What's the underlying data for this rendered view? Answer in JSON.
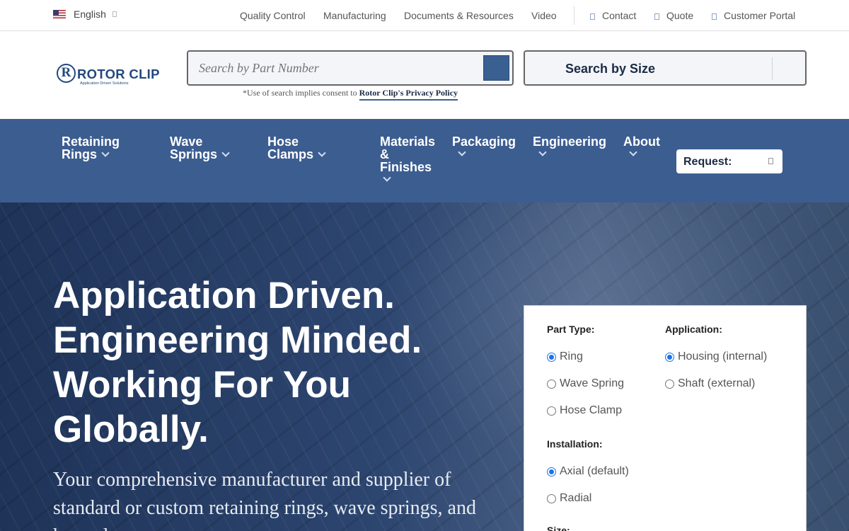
{
  "topbar": {
    "language": "English",
    "links": [
      "Quality Control",
      "Manufacturing",
      "Documents & Resources",
      "Video"
    ],
    "contact": "Contact",
    "quote": "Quote",
    "portal": "Customer Portal"
  },
  "logo": {
    "name": "ROTOR CLIP",
    "initial": "R",
    "tagline": "Application Driven Solutions"
  },
  "search": {
    "part_placeholder": "Search by Part Number",
    "size_label": "Search by Size",
    "privacy_prefix": "*Use of search implies consent to ",
    "privacy_link": "Rotor Clip's Privacy Policy"
  },
  "nav": {
    "items": [
      "Retaining Rings",
      "Wave Springs",
      "Hose Clamps",
      "Materials & Finishes",
      "Packaging",
      "Engineering",
      "About"
    ],
    "request": "Request:"
  },
  "hero": {
    "title_lines": [
      "Application Driven.",
      "Engineering Minded.",
      "Working For You",
      "Globally."
    ],
    "subtitle": "Your comprehensive manufacturer and supplier of standard or custom retaining rings, wave springs, and hose clamps."
  },
  "filter": {
    "part_type_label": "Part Type:",
    "part_types": [
      "Ring",
      "Wave Spring",
      "Hose Clamp"
    ],
    "application_label": "Application:",
    "applications": [
      "Housing (internal)",
      "Shaft (external)"
    ],
    "installation_label": "Installation:",
    "installations": [
      "Axial (default)",
      "Radial"
    ],
    "size_label": "Size:"
  },
  "colors": {
    "brand_blue": "#3c5d90",
    "logo_blue": "#24487e",
    "radio_selected": "#1a73e8"
  }
}
